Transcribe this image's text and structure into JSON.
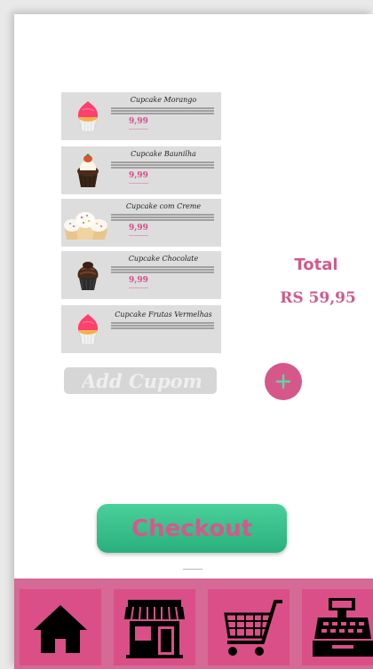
{
  "cart": {
    "items": [
      {
        "name": "Cupcake Morango",
        "price": "9,99",
        "image": "pink-frosting-cupcake"
      },
      {
        "name": "Cupcake Baunilha",
        "price": "9,99",
        "image": "chocolate-cupcake-with-cream"
      },
      {
        "name": "Cupcake com Creme",
        "price": "9,99",
        "image": "cream-sprinkle-cupcakes"
      },
      {
        "name": "Cupcake Chocolate",
        "price": "9,99",
        "image": "chocolate-swirl-cupcake"
      },
      {
        "name": "Cupcake Frutas Vermelhas",
        "price": "",
        "image": "pink-frosting-cupcake"
      }
    ]
  },
  "coupon": {
    "placeholder": "Add Cupom"
  },
  "summary": {
    "total_label": "Total",
    "total_value": "RS 59,95"
  },
  "checkout": {
    "label": "Checkout"
  },
  "nav": {
    "icons": [
      "home-icon",
      "store-icon",
      "cart-icon",
      "cash-register-icon"
    ]
  },
  "colors": {
    "brand_pink": "#d6588a",
    "checkout_green": "#2fb882",
    "nav_bg": "#d46a95",
    "card_bg": "#dddddd"
  }
}
